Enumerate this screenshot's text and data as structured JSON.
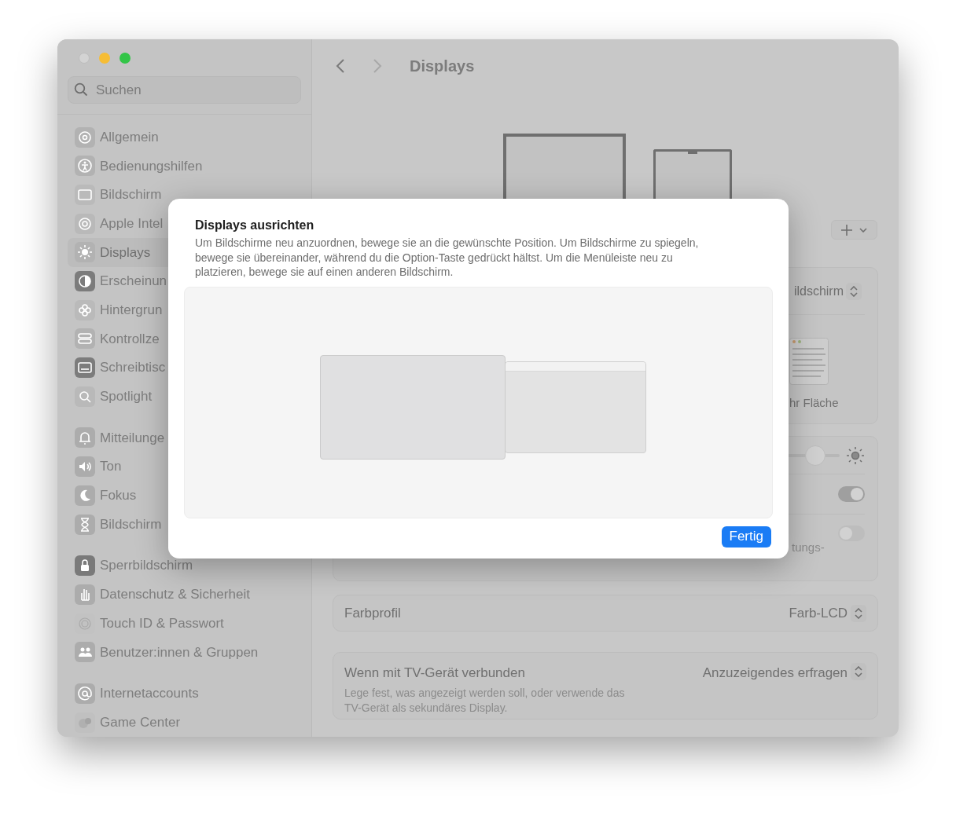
{
  "window": {
    "title": "Displays"
  },
  "sidebar": {
    "search": {
      "placeholder": "Suchen"
    },
    "groups": [
      {
        "items": [
          {
            "label": "Allgemein",
            "selected": false
          },
          {
            "label": "Bedienungshilfen",
            "selected": false
          },
          {
            "label": "Bildschirm",
            "selected": false
          },
          {
            "label": "Apple Intel",
            "selected": false
          },
          {
            "label": "Displays",
            "selected": true
          },
          {
            "label": "Erscheinun",
            "selected": false
          },
          {
            "label": "Hintergrun",
            "selected": false
          },
          {
            "label": "Kontrollze",
            "selected": false
          },
          {
            "label": "Schreibtisc",
            "selected": false
          },
          {
            "label": "Spotlight",
            "selected": false
          }
        ]
      },
      {
        "items": [
          {
            "label": "Mitteilunge",
            "selected": false
          },
          {
            "label": "Ton",
            "selected": false
          },
          {
            "label": "Fokus",
            "selected": false
          },
          {
            "label": "Bildschirm",
            "selected": false
          }
        ]
      },
      {
        "items": [
          {
            "label": "Sperrbildschirm",
            "selected": false
          },
          {
            "label": "Datenschutz & Sicherheit",
            "selected": false
          },
          {
            "label": "Touch ID & Passwort",
            "selected": false
          },
          {
            "label": "Benutzer:innen & Gruppen",
            "selected": false
          }
        ]
      },
      {
        "items": [
          {
            "label": "Internetaccounts",
            "selected": false
          },
          {
            "label": "Game Center",
            "selected": false
          }
        ]
      }
    ]
  },
  "settings": {
    "resolution_value": "ildschirm",
    "preview_caption": "hr Fläche",
    "brightness": {
      "level": 0.97
    },
    "toggles": [
      {
        "on": true
      },
      {
        "on": false,
        "caption": "tungs-"
      }
    ]
  },
  "color_profile": {
    "label": "Farbprofil",
    "value": "Farb-LCD"
  },
  "tv": {
    "label": "Wenn mit TV-Gerät verbunden",
    "description": "Lege fest, was angezeigt werden soll, oder verwende das TV-Gerät als sekundäres Display.",
    "value": "Anzuzeigendes erfragen"
  },
  "dialog": {
    "title": "Displays ausrichten",
    "description": "Um Bildschirme neu anzuordnen, bewege sie an die gewünschte Position. Um Bildschirme zu spiegeln, bewege sie übereinander, während du die Option-Taste gedrückt hältst. Um die Menüleiste neu zu platzieren, bewege sie auf einen anderen Bildschirm.",
    "button": "Fertig"
  }
}
